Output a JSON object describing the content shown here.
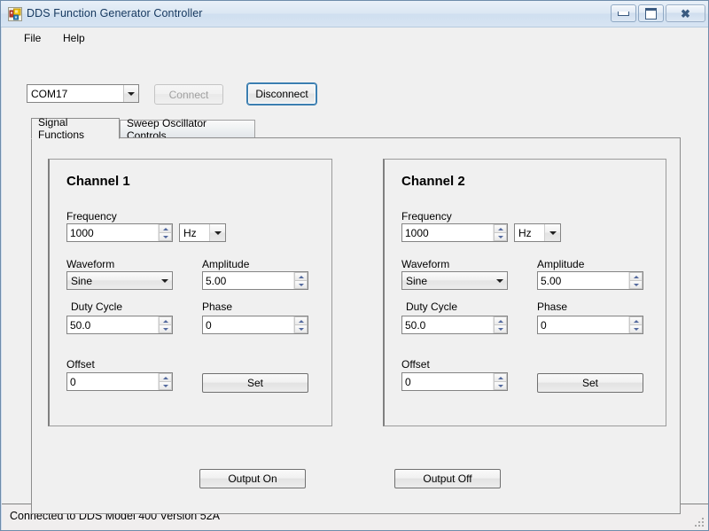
{
  "window": {
    "title": "DDS Function Generator Controller",
    "icon": "winforms-app-icon",
    "controls": {
      "minimize": "minimize-icon",
      "maximize": "maximize-icon",
      "close": "close-icon"
    }
  },
  "menu": {
    "items": [
      {
        "label": "File"
      },
      {
        "label": "Help"
      }
    ]
  },
  "connection": {
    "port": {
      "value": "COM17"
    },
    "connect_label": "Connect",
    "disconnect_label": "Disconnect"
  },
  "tabs": [
    {
      "label": "Signal Functions",
      "active": true
    },
    {
      "label": "Sweep Oscillator Controls",
      "active": false
    }
  ],
  "channels": [
    {
      "title": "Channel 1",
      "frequency": {
        "label": "Frequency",
        "value": "1000",
        "unit": "Hz"
      },
      "waveform": {
        "label": "Waveform",
        "value": "Sine"
      },
      "amplitude": {
        "label": "Amplitude",
        "value": "5.00"
      },
      "duty_cycle": {
        "label": "Duty Cycle",
        "value": "50.0"
      },
      "phase": {
        "label": "Phase",
        "value": "0"
      },
      "offset": {
        "label": "Offset",
        "value": "0"
      },
      "set_label": "Set"
    },
    {
      "title": "Channel 2",
      "frequency": {
        "label": "Frequency",
        "value": "1000",
        "unit": "Hz"
      },
      "waveform": {
        "label": "Waveform",
        "value": "Sine"
      },
      "amplitude": {
        "label": "Amplitude",
        "value": "5.00"
      },
      "duty_cycle": {
        "label": "Duty Cycle",
        "value": "50.0"
      },
      "phase": {
        "label": "Phase",
        "value": "0"
      },
      "offset": {
        "label": "Offset",
        "value": "0"
      },
      "set_label": "Set"
    }
  ],
  "output": {
    "on_label": "Output On",
    "off_label": "Output Off"
  },
  "status": {
    "text": "Connected to DDS Model 400 Version 52A"
  },
  "colors": {
    "title_text": "#14375e",
    "focus_border": "#3c7fb1",
    "spin_arrow": "#53699e",
    "panel_bg": "#f0f0f0"
  }
}
